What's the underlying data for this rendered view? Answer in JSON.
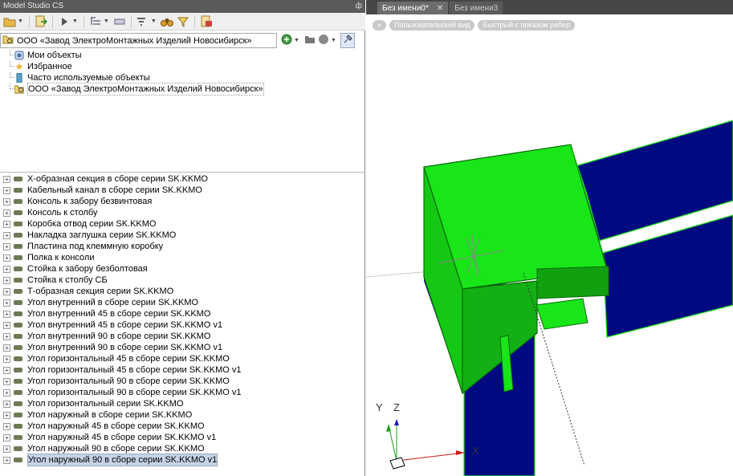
{
  "panel": {
    "title": "Model Studio CS",
    "pin": "ф"
  },
  "toolbar": {
    "icons": [
      "folder-open-icon",
      "dropdown-arrow",
      "import-icon",
      "play-icon",
      "dropdown-arrow",
      "tree-view-icon",
      "list-icon",
      "filter-icon",
      "binoculars-icon",
      "funnel-icon",
      "export-icon"
    ]
  },
  "path": {
    "value": "ООО «Завод ЭлектроМонтажных Изделий Новосибирск»"
  },
  "tree": [
    {
      "label": "Мои объекты",
      "icon": "my-objects-icon"
    },
    {
      "label": "Избранное",
      "icon": "star-icon"
    },
    {
      "label": "Часто используемые объекты",
      "icon": "frequent-icon"
    },
    {
      "label": "ООО «Завод ЭлектроМонтажных Изделий Новосибирск»",
      "icon": "company-folder-icon"
    }
  ],
  "items": [
    "X-образная секция в сборе серии SK.KKMO",
    "Кабельный канал в сборе серии SK.KKMO",
    "Консоль к забору безвинтовая",
    "Консоль к столбу",
    "Коробка отвод серии SK.KKMO",
    "Накладка заглушка серии SK.KKMO",
    "Пластина под клеммную коробку",
    "Полка к консоли",
    "Стойка к забору безболтовая",
    "Стойка к столбу СБ",
    "Т-образная секция серии SK.KKMO",
    "Угол внутренний в сборе серии SK.KKMO",
    "Угол внутренний 45 в сборе серии SK.KKMO",
    "Угол внутренний 45 в сборе серии SK.KKMO v1",
    "Угол внутренний 90 в сборе серии SK.KKMO",
    "Угол внутренний 90 в сборе серии SK.KKMO v1",
    "Угол горизонтальный 45 в сборе серии SK.KKMO",
    "Угол горизонтальный 45 в сборе серии SK.KKMO v1",
    "Угол горизонтальный 90 в сборе серии SK.KKMO",
    "Угол горизонтальный 90 в сборе серии SK.KKMO v1",
    "Угол горизонтальный серии SK.KKMO",
    "Угол наружный в сборе серии SK.KKMO",
    "Угол наружный 45 в сборе серии SK.KKMO",
    "Угол наружный 45 в сборе серии SK.KKMO v1",
    "Угол наружный 90 в сборе серии SK.KKMO",
    "Угол наружный 90 в сборе серии SK.KKMO v1"
  ],
  "selected_index": 25,
  "tabs": [
    {
      "label": "Без имени0*",
      "active": true,
      "close": "✕"
    },
    {
      "label": "Без имени3",
      "active": false
    }
  ],
  "viewport": {
    "pills": [
      "«",
      "Пользовательский вид",
      "Быстрый с показом ребер"
    ],
    "axes": {
      "y": "Y",
      "z": "Z",
      "x": "X"
    }
  },
  "colors": {
    "green": "#19e619",
    "navy": "#000a80",
    "selection": "#c5d3e6"
  }
}
